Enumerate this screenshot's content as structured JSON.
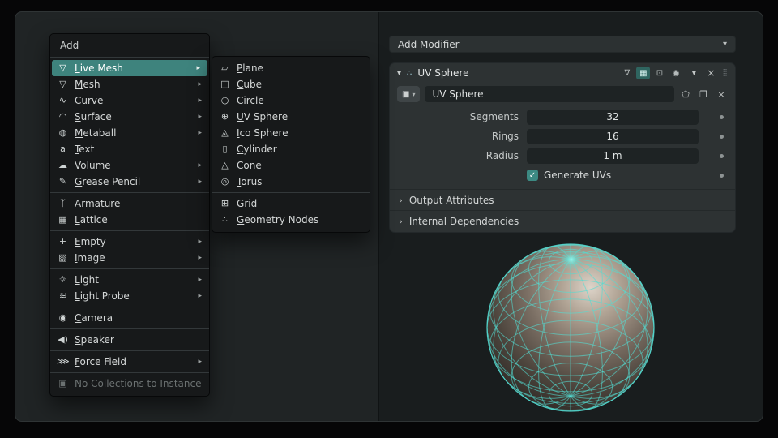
{
  "colors": {
    "accent": "#3e837d",
    "wire": "#54dcd2",
    "panel_bg": "#2d3233",
    "field_bg": "#1e2324"
  },
  "ui": {
    "submenu_arrow": "▸",
    "chevron_down": "▾",
    "chevron_right": "›",
    "close": "×",
    "check": "✓",
    "grip": "⣿"
  },
  "add_menu": {
    "title": "Add",
    "items": [
      {
        "label": "Live Mesh",
        "glyph": "▽"
      },
      {
        "label": "Mesh",
        "glyph": "▽"
      },
      {
        "label": "Curve",
        "glyph": "∿"
      },
      {
        "label": "Surface",
        "glyph": "◠"
      },
      {
        "label": "Metaball",
        "glyph": "◍"
      },
      {
        "label": "Text",
        "glyph": "a"
      },
      {
        "label": "Volume",
        "glyph": "☁"
      },
      {
        "label": "Grease Pencil",
        "glyph": "✎"
      },
      {
        "label": "Armature",
        "glyph": "ᛉ"
      },
      {
        "label": "Lattice",
        "glyph": "▦"
      },
      {
        "label": "Empty",
        "glyph": "+"
      },
      {
        "label": "Image",
        "glyph": "▧"
      },
      {
        "label": "Light",
        "glyph": "☼"
      },
      {
        "label": "Light Probe",
        "glyph": "≋"
      },
      {
        "label": "Camera",
        "glyph": "◉"
      },
      {
        "label": "Speaker",
        "glyph": "◀)"
      },
      {
        "label": "Force Field",
        "glyph": "⋙"
      },
      {
        "label": "No Collections to Instance",
        "glyph": "▣"
      }
    ]
  },
  "mesh_submenu": {
    "items": [
      {
        "label": "Plane",
        "glyph": "▱"
      },
      {
        "label": "Cube",
        "glyph": "□"
      },
      {
        "label": "Circle",
        "glyph": "○"
      },
      {
        "label": "UV Sphere",
        "glyph": "⊕"
      },
      {
        "label": "Ico Sphere",
        "glyph": "◬"
      },
      {
        "label": "Cylinder",
        "glyph": "▯"
      },
      {
        "label": "Cone",
        "glyph": "△"
      },
      {
        "label": "Torus",
        "glyph": "◎"
      },
      {
        "label": "Grid",
        "glyph": "⊞"
      },
      {
        "label": "Geometry Nodes",
        "glyph": "∴"
      }
    ]
  },
  "properties": {
    "add_modifier_label": "Add Modifier",
    "modifier": {
      "type_icon_glyph": "∴",
      "name": "UV Sphere",
      "toggles": [
        "∇",
        "▦",
        "⊡",
        "◉"
      ],
      "datablock": {
        "selector_glyph": "▣",
        "name": "UV Sphere",
        "shield_glyph": "⬠",
        "copy_glyph": "❐"
      },
      "rows": [
        {
          "label": "Segments",
          "value": "32"
        },
        {
          "label": "Rings",
          "value": "16"
        },
        {
          "label": "Radius",
          "value": "1 m"
        }
      ],
      "checkbox_label": "Generate UVs",
      "sections": [
        {
          "label": "Output Attributes"
        },
        {
          "label": "Internal Dependencies"
        }
      ]
    }
  }
}
